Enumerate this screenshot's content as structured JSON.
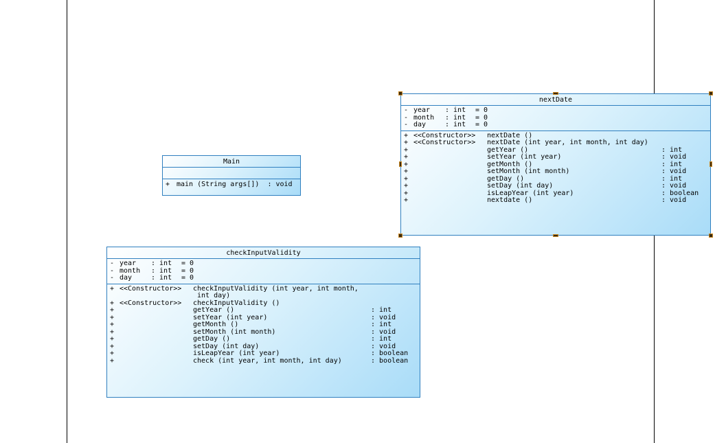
{
  "classes": {
    "main": {
      "name": "Main",
      "methods": [
        {
          "vis": "+",
          "sig": "main (String args[])  : void"
        }
      ]
    },
    "nextDate": {
      "name": "nextDate",
      "attributes": [
        {
          "vis": "-",
          "name": "year",
          "type": ": int",
          "default": "= 0"
        },
        {
          "vis": "-",
          "name": "month",
          "type": ": int",
          "default": "= 0"
        },
        {
          "vis": "-",
          "name": "day",
          "type": ": int",
          "default": "= 0"
        }
      ],
      "methods": [
        {
          "vis": "+",
          "stereo": "<<Constructor>>",
          "sig": "nextDate ()",
          "ret": ""
        },
        {
          "vis": "+",
          "stereo": "<<Constructor>>",
          "sig": "nextDate (int year, int month, int day)",
          "ret": ""
        },
        {
          "vis": "+",
          "stereo": "",
          "sig": "getYear ()",
          "ret": ": int"
        },
        {
          "vis": "+",
          "stereo": "",
          "sig": "setYear (int year)",
          "ret": ": void"
        },
        {
          "vis": "+",
          "stereo": "",
          "sig": "getMonth ()",
          "ret": ": int"
        },
        {
          "vis": "+",
          "stereo": "",
          "sig": "setMonth (int month)",
          "ret": ": void"
        },
        {
          "vis": "+",
          "stereo": "",
          "sig": "getDay ()",
          "ret": ": int"
        },
        {
          "vis": "+",
          "stereo": "",
          "sig": "setDay (int day)",
          "ret": ": void"
        },
        {
          "vis": "+",
          "stereo": "",
          "sig": "isLeapYear (int year)",
          "ret": ": boolean"
        },
        {
          "vis": "+",
          "stereo": "",
          "sig": "nextdate ()",
          "ret": ": void"
        }
      ]
    },
    "checkInputValidity": {
      "name": "checkInputValidity",
      "attributes": [
        {
          "vis": "-",
          "name": "year",
          "type": ": int",
          "default": "= 0"
        },
        {
          "vis": "-",
          "name": "month",
          "type": ": int",
          "default": "= 0"
        },
        {
          "vis": "-",
          "name": "day",
          "type": ": int",
          "default": "= 0"
        }
      ],
      "methods": [
        {
          "vis": "+",
          "stereo": "<<Constructor>>",
          "sig": "checkInputValidity (int year, int month,",
          "ret": ""
        },
        {
          "vis": "",
          "stereo": "",
          "sig": " int day)",
          "ret": ""
        },
        {
          "vis": "+",
          "stereo": "<<Constructor>>",
          "sig": "checkInputValidity ()",
          "ret": ""
        },
        {
          "vis": "+",
          "stereo": "",
          "sig": "getYear ()",
          "ret": ": int"
        },
        {
          "vis": "+",
          "stereo": "",
          "sig": "setYear (int year)",
          "ret": ": void"
        },
        {
          "vis": "+",
          "stereo": "",
          "sig": "getMonth ()",
          "ret": ": int"
        },
        {
          "vis": "+",
          "stereo": "",
          "sig": "setMonth (int month)",
          "ret": ": void"
        },
        {
          "vis": "+",
          "stereo": "",
          "sig": "getDay ()",
          "ret": ": int"
        },
        {
          "vis": "+",
          "stereo": "",
          "sig": "setDay (int day)",
          "ret": ": void"
        },
        {
          "vis": "+",
          "stereo": "",
          "sig": "isLeapYear (int year)",
          "ret": ": boolean"
        },
        {
          "vis": "+",
          "stereo": "",
          "sig": "check (int year, int month, int day)",
          "ret": ": boolean"
        }
      ]
    }
  },
  "colors": {
    "border": "#2f7fbf",
    "fill_light": "#dcf2fc",
    "fill_dark": "#a9dcf8",
    "selection_handle": "#3b2a10"
  }
}
